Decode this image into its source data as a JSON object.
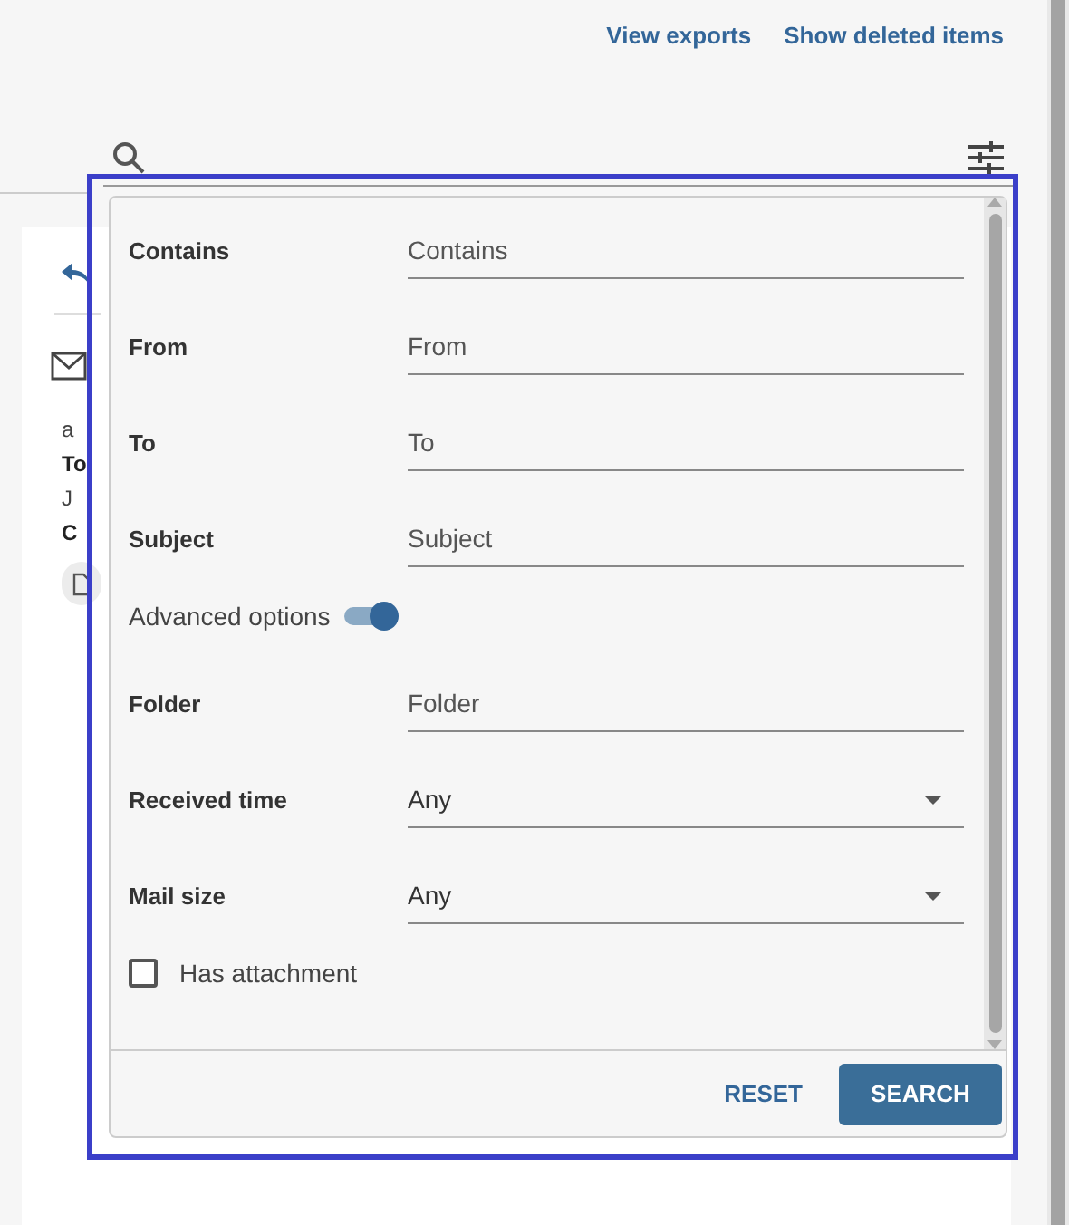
{
  "links": [
    {
      "label": "View exports"
    },
    {
      "label": "Show deleted items"
    }
  ],
  "background": {
    "texts": [
      {
        "kind": "plain",
        "text": "a"
      },
      {
        "kind": "bold",
        "text": "To"
      },
      {
        "kind": "plain",
        "text": "J"
      },
      {
        "kind": "bold",
        "text": "C"
      }
    ]
  },
  "filter": {
    "fields": [
      {
        "kind": "text",
        "label": "Contains",
        "placeholder": "Contains"
      },
      {
        "kind": "text",
        "label": "From",
        "placeholder": "From"
      },
      {
        "kind": "text",
        "label": "To",
        "placeholder": "To"
      },
      {
        "kind": "text",
        "label": "Subject",
        "placeholder": "Subject"
      },
      {
        "kind": "toggle",
        "label": "Advanced options",
        "on": true
      },
      {
        "kind": "text",
        "label": "Folder",
        "placeholder": "Folder"
      },
      {
        "kind": "select",
        "label": "Received time",
        "value": "Any"
      },
      {
        "kind": "select",
        "label": "Mail size",
        "value": "Any"
      },
      {
        "kind": "checkbox",
        "label": "Has attachment",
        "checked": false
      }
    ],
    "buttons": [
      {
        "kind": "text",
        "label": "RESET"
      },
      {
        "kind": "primary",
        "label": "SEARCH"
      }
    ]
  }
}
